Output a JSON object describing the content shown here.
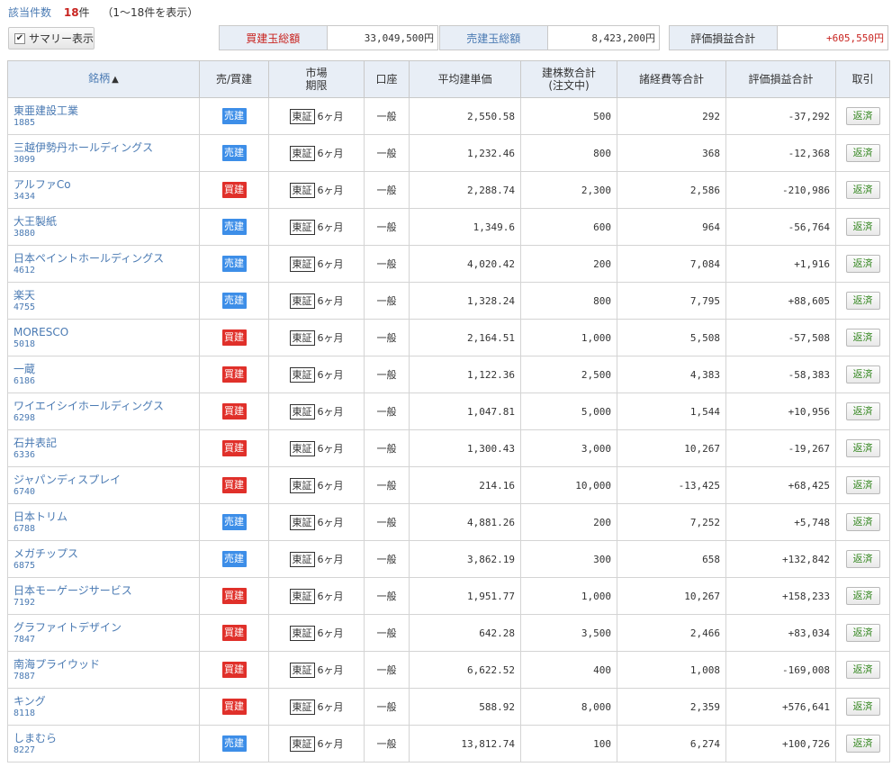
{
  "header": {
    "count_label": "該当件数",
    "count": "18",
    "count_unit": "件",
    "range": "（1〜18件を表示）"
  },
  "summary_toggle": {
    "label": "サマリー表示",
    "checked": true
  },
  "totals": [
    {
      "label": "買建玉総額",
      "value": "33,049,500円"
    },
    {
      "label": "売建玉総額",
      "value": "8,423,200円"
    },
    {
      "label": "評価損益合計",
      "value": "+605,550円"
    }
  ],
  "table": {
    "headers": {
      "name": "銘柄",
      "name_sort": "▲",
      "side": "売/買建",
      "market_l1": "市場",
      "market_l2": "期限",
      "account": "口座",
      "avg_price": "平均建単価",
      "qty_l1": "建株数合計",
      "qty_l2": "(注文中)",
      "fees": "諸経費等合計",
      "pl": "評価損益合計",
      "trade": "取引"
    },
    "rows": [
      {
        "name": "東亜建設工業",
        "code": "1885",
        "side": "売建",
        "market": "東証",
        "term": "6ヶ月",
        "account": "一般",
        "avg": "2,550.58",
        "qty": "500",
        "fees": "292",
        "pl": "-37,292",
        "action": "返済"
      },
      {
        "name": "三越伊勢丹ホールディングス",
        "code": "3099",
        "side": "売建",
        "market": "東証",
        "term": "6ヶ月",
        "account": "一般",
        "avg": "1,232.46",
        "qty": "800",
        "fees": "368",
        "pl": "-12,368",
        "action": "返済"
      },
      {
        "name": "アルファCo",
        "code": "3434",
        "side": "買建",
        "market": "東証",
        "term": "6ヶ月",
        "account": "一般",
        "avg": "2,288.74",
        "qty": "2,300",
        "fees": "2,586",
        "pl": "-210,986",
        "action": "返済"
      },
      {
        "name": "大王製紙",
        "code": "3880",
        "side": "売建",
        "market": "東証",
        "term": "6ヶ月",
        "account": "一般",
        "avg": "1,349.6",
        "qty": "600",
        "fees": "964",
        "pl": "-56,764",
        "action": "返済"
      },
      {
        "name": "日本ペイントホールディングス",
        "code": "4612",
        "side": "売建",
        "market": "東証",
        "term": "6ヶ月",
        "account": "一般",
        "avg": "4,020.42",
        "qty": "200",
        "fees": "7,084",
        "pl": "+1,916",
        "action": "返済"
      },
      {
        "name": "楽天",
        "code": "4755",
        "side": "売建",
        "market": "東証",
        "term": "6ヶ月",
        "account": "一般",
        "avg": "1,328.24",
        "qty": "800",
        "fees": "7,795",
        "pl": "+88,605",
        "action": "返済"
      },
      {
        "name": "MORESCO",
        "code": "5018",
        "side": "買建",
        "market": "東証",
        "term": "6ヶ月",
        "account": "一般",
        "avg": "2,164.51",
        "qty": "1,000",
        "fees": "5,508",
        "pl": "-57,508",
        "action": "返済"
      },
      {
        "name": "一蔵",
        "code": "6186",
        "side": "買建",
        "market": "東証",
        "term": "6ヶ月",
        "account": "一般",
        "avg": "1,122.36",
        "qty": "2,500",
        "fees": "4,383",
        "pl": "-58,383",
        "action": "返済"
      },
      {
        "name": "ワイエイシイホールディングス",
        "code": "6298",
        "side": "買建",
        "market": "東証",
        "term": "6ヶ月",
        "account": "一般",
        "avg": "1,047.81",
        "qty": "5,000",
        "fees": "1,544",
        "pl": "+10,956",
        "action": "返済"
      },
      {
        "name": "石井表記",
        "code": "6336",
        "side": "買建",
        "market": "東証",
        "term": "6ヶ月",
        "account": "一般",
        "avg": "1,300.43",
        "qty": "3,000",
        "fees": "10,267",
        "pl": "-19,267",
        "action": "返済"
      },
      {
        "name": "ジャパンディスプレイ",
        "code": "6740",
        "side": "買建",
        "market": "東証",
        "term": "6ヶ月",
        "account": "一般",
        "avg": "214.16",
        "qty": "10,000",
        "fees": "-13,425",
        "pl": "+68,425",
        "action": "返済"
      },
      {
        "name": "日本トリム",
        "code": "6788",
        "side": "売建",
        "market": "東証",
        "term": "6ヶ月",
        "account": "一般",
        "avg": "4,881.26",
        "qty": "200",
        "fees": "7,252",
        "pl": "+5,748",
        "action": "返済"
      },
      {
        "name": "メガチップス",
        "code": "6875",
        "side": "売建",
        "market": "東証",
        "term": "6ヶ月",
        "account": "一般",
        "avg": "3,862.19",
        "qty": "300",
        "fees": "658",
        "pl": "+132,842",
        "action": "返済"
      },
      {
        "name": "日本モーゲージサービス",
        "code": "7192",
        "side": "買建",
        "market": "東証",
        "term": "6ヶ月",
        "account": "一般",
        "avg": "1,951.77",
        "qty": "1,000",
        "fees": "10,267",
        "pl": "+158,233",
        "action": "返済"
      },
      {
        "name": "グラファイトデザイン",
        "code": "7847",
        "side": "買建",
        "market": "東証",
        "term": "6ヶ月",
        "account": "一般",
        "avg": "642.28",
        "qty": "3,500",
        "fees": "2,466",
        "pl": "+83,034",
        "action": "返済"
      },
      {
        "name": "南海プライウッド",
        "code": "7887",
        "side": "買建",
        "market": "東証",
        "term": "6ヶ月",
        "account": "一般",
        "avg": "6,622.52",
        "qty": "400",
        "fees": "1,008",
        "pl": "-169,008",
        "action": "返済"
      },
      {
        "name": "キング",
        "code": "8118",
        "side": "買建",
        "market": "東証",
        "term": "6ヶ月",
        "account": "一般",
        "avg": "588.92",
        "qty": "8,000",
        "fees": "2,359",
        "pl": "+576,641",
        "action": "返済"
      },
      {
        "name": "しまむら",
        "code": "8227",
        "side": "売建",
        "market": "東証",
        "term": "6ヶ月",
        "account": "一般",
        "avg": "13,812.74",
        "qty": "100",
        "fees": "6,274",
        "pl": "+100,726",
        "action": "返済"
      }
    ]
  },
  "colors": {
    "sell_badge": "#3d8ee8",
    "buy_badge": "#e0302a",
    "header_bg": "#e8eef6",
    "link": "#4a7ab3",
    "profit": "#d32a2a",
    "loss": "#2b3da8",
    "return_button_text": "#3a8a26"
  }
}
